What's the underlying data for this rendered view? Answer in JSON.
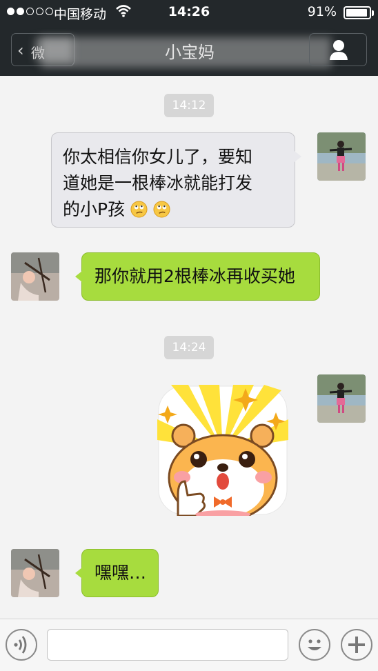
{
  "status_bar": {
    "signal_bars_filled": 2,
    "signal_bars_total": 5,
    "carrier": "中国移动",
    "time": "14:26",
    "battery_percent": "91%",
    "battery_level": 0.91
  },
  "nav": {
    "back_label": "微",
    "title": "小宝妈",
    "profile_icon": "person-icon"
  },
  "messages": [
    {
      "type": "timestamp",
      "text": "14:12"
    },
    {
      "type": "text",
      "side": "right",
      "style": "white",
      "lines": [
        "你太相信你女儿了，要知",
        "道她是一根棒冰就能打发",
        "的小P孩"
      ],
      "emojis": [
        "rolling-eyes-emoji",
        "rolling-eyes-emoji"
      ]
    },
    {
      "type": "text",
      "side": "left",
      "style": "green",
      "text": "那你就用2根棒冰再收买她"
    },
    {
      "type": "timestamp",
      "text": "14:24"
    },
    {
      "type": "sticker",
      "side": "right",
      "sticker": "hamster-thumbs-up-sticker"
    },
    {
      "type": "text",
      "side": "left",
      "style": "green",
      "text": "嘿嘿…"
    }
  ],
  "input_bar": {
    "voice_icon": "voice-icon",
    "input_value": "",
    "emoji_icon": "smiley-icon",
    "more_icon": "plus-icon"
  },
  "colors": {
    "header_bg": "#23282b",
    "chat_bg": "#f3f3f3",
    "green_bubble": "#a7dc3e",
    "white_bubble": "#e9e9ed"
  }
}
